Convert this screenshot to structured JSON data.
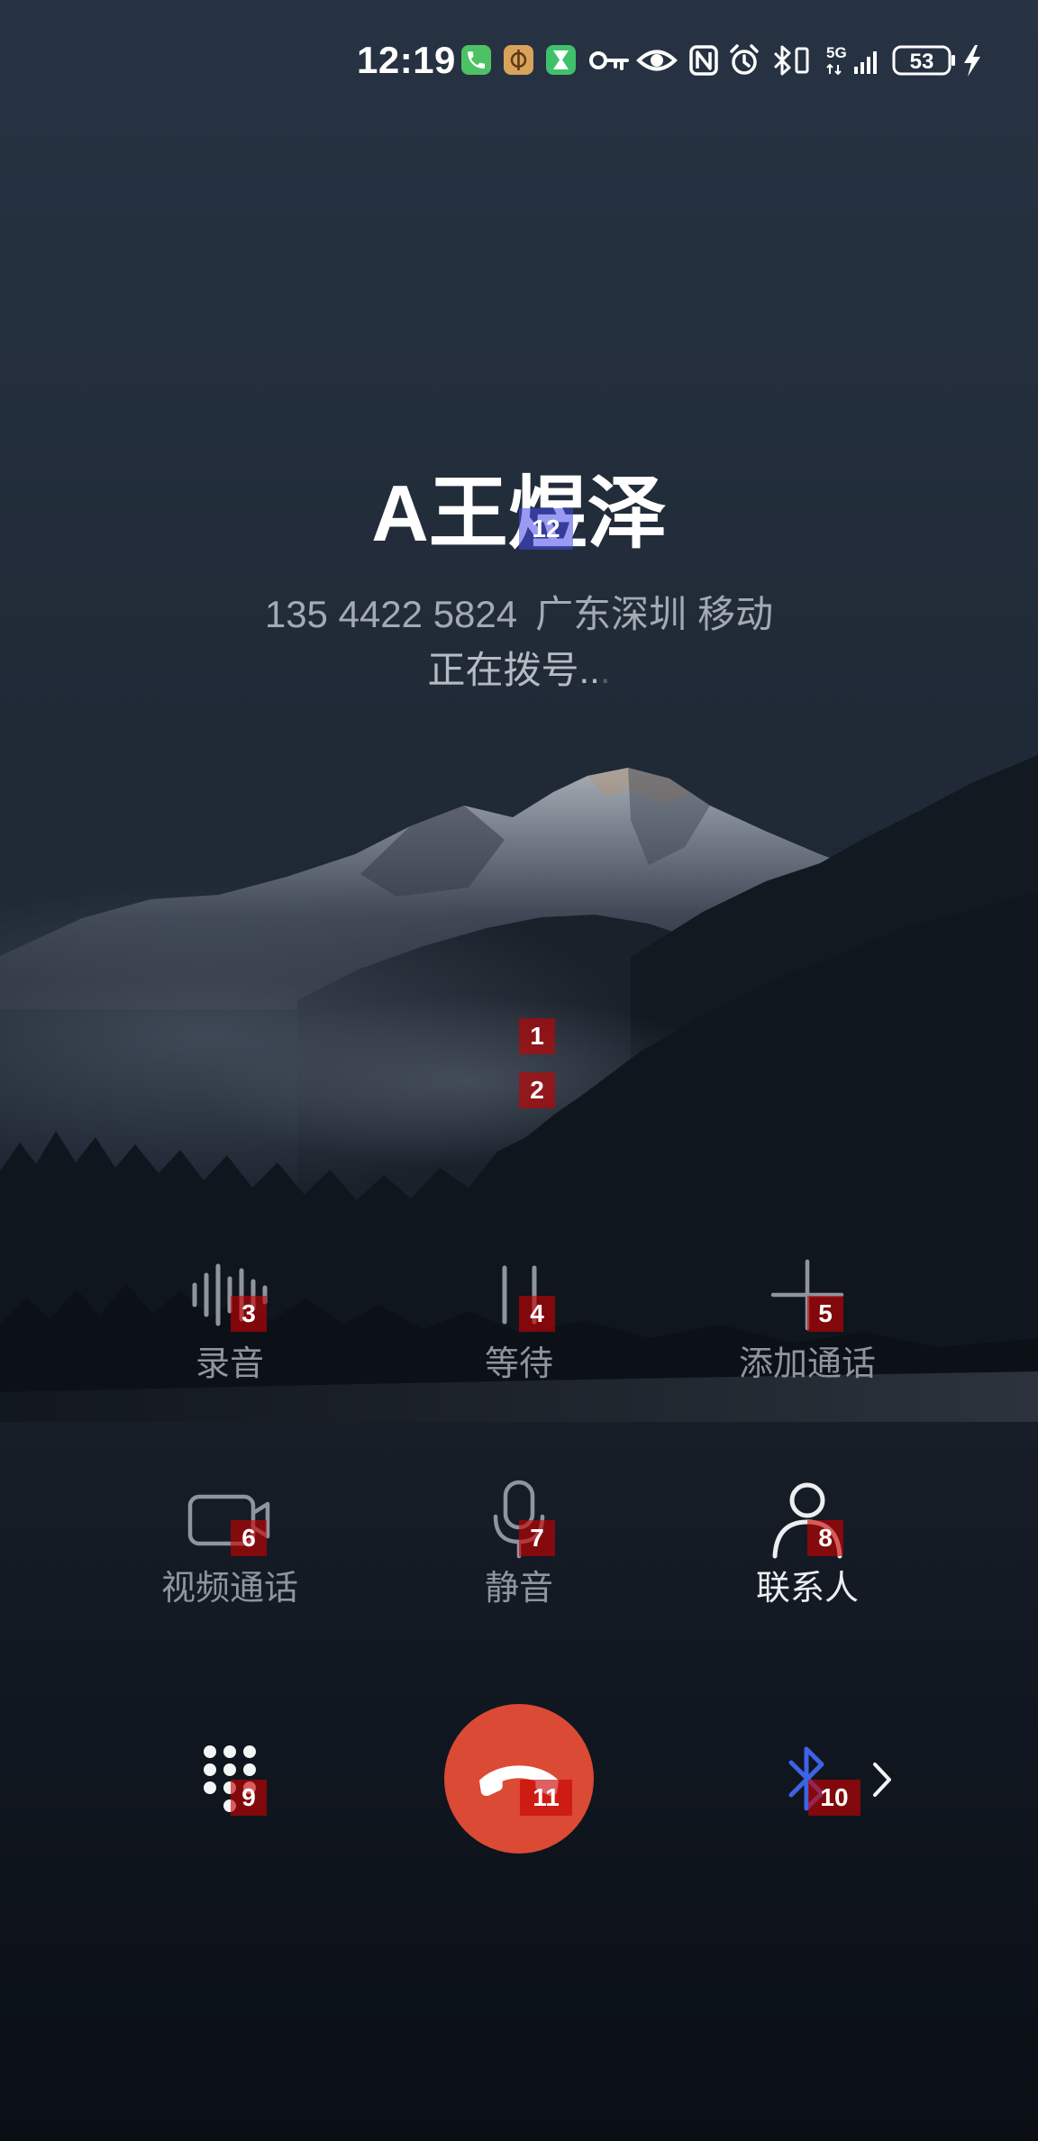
{
  "status_bar": {
    "time": "12:19",
    "notification_icons": [
      "phone-icon",
      "app-icon",
      "hourglass-icon"
    ],
    "system_icons": [
      "key-icon",
      "eye-icon",
      "nfc-icon",
      "alarm-icon",
      "bluetooth-vibrate-icon",
      "signal-icon",
      "battery-icon",
      "charging-icon"
    ],
    "network": "5G",
    "battery": "53",
    "charging": true
  },
  "caller": {
    "name": "A王煜泽",
    "number": "135 4422 5824",
    "location": "广东深圳",
    "carrier": "移动",
    "status": "正在拨号..",
    "status_fading_dot": "."
  },
  "controls": [
    {
      "label": "录音",
      "icon": "waveform-icon",
      "enabled": false
    },
    {
      "label": "等待",
      "icon": "pause-icon",
      "enabled": false
    },
    {
      "label": "添加通话",
      "icon": "plus-icon",
      "enabled": false
    },
    {
      "label": "视频通话",
      "icon": "video-camera-icon",
      "enabled": false
    },
    {
      "label": "静音",
      "icon": "microphone-icon",
      "enabled": false
    },
    {
      "label": "联系人",
      "icon": "person-icon",
      "enabled": true
    }
  ],
  "bottom_bar": {
    "keypad_icon": "dialpad-icon",
    "end_call_icon": "hang-up-icon",
    "audio_route_icon": "bluetooth-icon",
    "audio_route_more_icon": "chevron-right-icon"
  },
  "colors": {
    "end_call": "#db4a34",
    "bluetooth": "#3d63e6",
    "disabled": "#8f959d",
    "active": "#eceef0",
    "notification_green": "#4cc264",
    "notification_orange": "#d9a35b",
    "hourglass_green": "#3fc16b"
  },
  "annotation_marks": [
    "1",
    "2",
    "3",
    "4",
    "5",
    "6",
    "7",
    "8",
    "9",
    "10",
    "11",
    "12"
  ]
}
